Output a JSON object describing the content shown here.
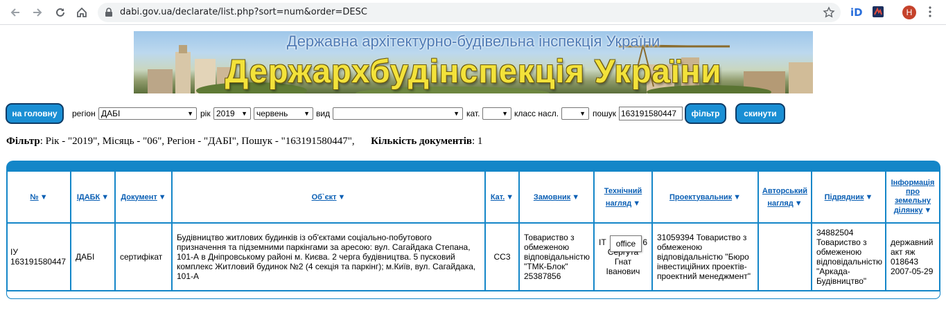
{
  "browser": {
    "url": "dabi.gov.ua/declarate/list.php?sort=num&order=DESC",
    "avatar_letter": "Н"
  },
  "banner": {
    "subtitle": "Державна архітектурно-будівельна інспекція України",
    "title": "Держархбудінспекція України"
  },
  "filters": {
    "home_button": "на головну",
    "region_label": "регіон",
    "region_value": "ДАБІ",
    "year_label": "рік",
    "year_value": "2019",
    "month_value": "червень",
    "type_label": "вид",
    "type_value": "",
    "cat_label": "кат.",
    "cat_value": "",
    "class_label": "класс насл.",
    "class_value": "",
    "search_label": "пошук",
    "search_value": "163191580447",
    "filter_button": "фільтр",
    "reset_button": "скинути"
  },
  "summary": {
    "filter_label": "Фільтр",
    "filter_text": ": Рік - \"2019\", Місяць - \"06\", Регіон - \"ДАБІ\", Пошук - \"163191580447\",",
    "count_label": "Кількість документів",
    "count_value": ": 1"
  },
  "table": {
    "headers": {
      "num": "№",
      "idabk": "ІДАБК",
      "document": "Документ",
      "object": "Об`єкт",
      "cat": "Кат.",
      "customer": "Замовник",
      "tech_1": "Технічний",
      "tech_2": "нагляд",
      "designer": "Проектувальник",
      "author_1": "Авторський",
      "author_2": "нагляд",
      "contractor": "Підрядник",
      "land_1": "Інформація",
      "land_2": "про",
      "land_3": "земельну",
      "land_4": "ділянку"
    },
    "row": {
      "num_1": "ІУ",
      "num_2": "163191580447",
      "idabk": "ДАБІ",
      "document": "сертифікат",
      "object": "Будівництво житлових будинків із об'єктами соціально-побутового призначення та підземними паркінгами за аресою: вул. Сагайдака Степана, 101-А в Дніпровському районі м. Києва. 2 черга будівництва. 5 пусковий комплекс Житловий будинок №2 (4 секція та паркінг); м.Київ, вул. Сагайдака, 101-А",
      "cat": "СС3",
      "customer": "Товариство з обмеженою відповідальністю \"ТМК-Блок\" 25387856",
      "tech_prefix": "ІТ",
      "tech_suffix": "6",
      "tech_name_1": "Сергута",
      "tech_name_2": "Гнат",
      "tech_name_3": "Іванович",
      "designer": "31059394 Товариство з обмеженою відповідальністю \"Бюро інвестиційних проектів-проектний менеджмент\"",
      "author": "",
      "contractor": "34882504 Товариство з обмеженою відповідальністю \"Аркада-Будівництво\"",
      "land": "державний акт яж 018643 2007-05-29"
    },
    "tooltip": "office"
  }
}
